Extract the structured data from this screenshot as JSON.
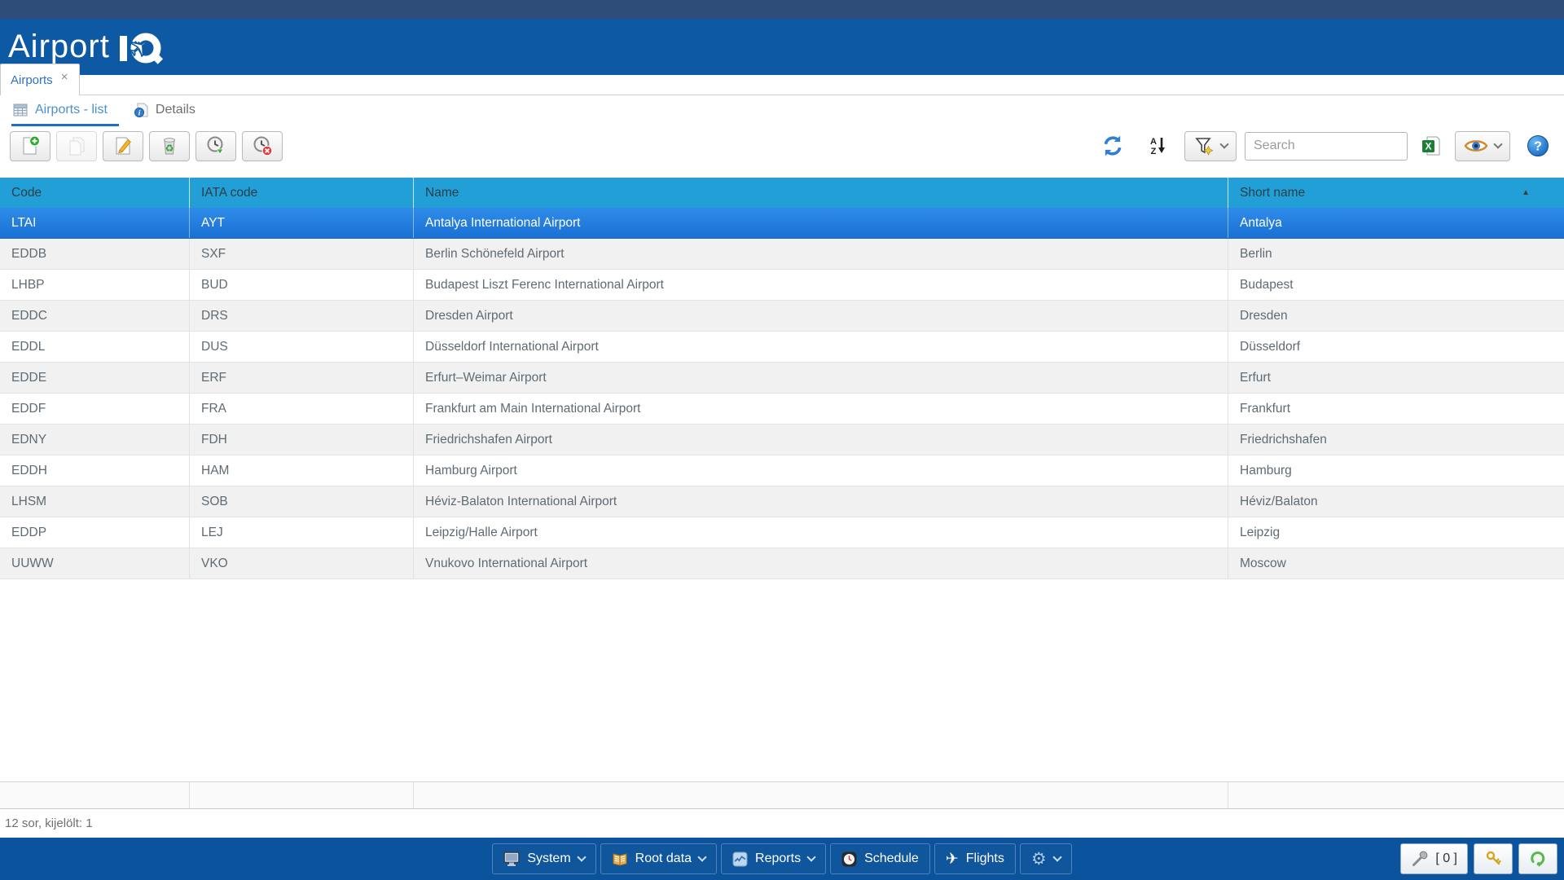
{
  "colors": {
    "top_strip": "#2e4e79",
    "header_blue": "#0d59a3",
    "grid_header_blue": "#229fd6",
    "selected_row_blue": "#1d78dc",
    "bottom_bar_blue": "#0b539c",
    "accent_link_blue": "#3c7fc0"
  },
  "app": {
    "title": "Airport"
  },
  "window_tab": {
    "label": "Airports",
    "close_glyph": "×"
  },
  "subtabs": [
    {
      "label": "Airports - list",
      "icon": "grid-icon",
      "active": true
    },
    {
      "label": "Details",
      "icon": "info-icon",
      "active": false
    }
  ],
  "toolbar": {
    "search_placeholder": "Search"
  },
  "grid": {
    "columns": [
      {
        "label": "Code",
        "key": "code"
      },
      {
        "label": "IATA code",
        "key": "iata"
      },
      {
        "label": "Name",
        "key": "name"
      },
      {
        "label": "Short name",
        "key": "short",
        "sort": "asc"
      }
    ],
    "selected_index": 0,
    "rows": [
      {
        "code": "LTAI",
        "iata": "AYT",
        "name": "Antalya International Airport",
        "short": "Antalya"
      },
      {
        "code": "EDDB",
        "iata": "SXF",
        "name": "Berlin Schönefeld Airport",
        "short": "Berlin"
      },
      {
        "code": "LHBP",
        "iata": "BUD",
        "name": "Budapest Liszt Ferenc International Airport",
        "short": "Budapest"
      },
      {
        "code": "EDDC",
        "iata": "DRS",
        "name": "Dresden Airport",
        "short": "Dresden"
      },
      {
        "code": "EDDL",
        "iata": "DUS",
        "name": "Düsseldorf International Airport",
        "short": "Düsseldorf"
      },
      {
        "code": "EDDE",
        "iata": "ERF",
        "name": "Erfurt–Weimar Airport",
        "short": "Erfurt"
      },
      {
        "code": "EDDF",
        "iata": "FRA",
        "name": "Frankfurt am Main International Airport",
        "short": "Frankfurt"
      },
      {
        "code": "EDNY",
        "iata": "FDH",
        "name": "Friedrichshafen Airport",
        "short": "Friedrichshafen"
      },
      {
        "code": "EDDH",
        "iata": "HAM",
        "name": "Hamburg Airport",
        "short": "Hamburg"
      },
      {
        "code": "LHSM",
        "iata": "SOB",
        "name": "Héviz-Balaton International Airport",
        "short": "Héviz/Balaton"
      },
      {
        "code": "EDDP",
        "iata": "LEJ",
        "name": "Leipzig/Halle Airport",
        "short": "Leipzig"
      },
      {
        "code": "UUWW",
        "iata": "VKO",
        "name": "Vnukovo International Airport",
        "short": "Moscow"
      }
    ]
  },
  "status_bar": {
    "text": "12 sor, kijelölt: 1"
  },
  "bottom_nav": [
    {
      "label": "System",
      "icon": "monitor-icon",
      "chevron": true
    },
    {
      "label": "Root data",
      "icon": "book-icon",
      "chevron": true
    },
    {
      "label": "Reports",
      "icon": "chart-icon",
      "chevron": true
    },
    {
      "label": "Schedule",
      "icon": "clock-icon",
      "chevron": false
    },
    {
      "label": "Flights",
      "icon": "plane-icon",
      "chevron": false
    },
    {
      "label": "",
      "icon": "gear-icon",
      "chevron": true
    }
  ],
  "bottom_right": {
    "wrench_counter": "[ 0 ]"
  }
}
